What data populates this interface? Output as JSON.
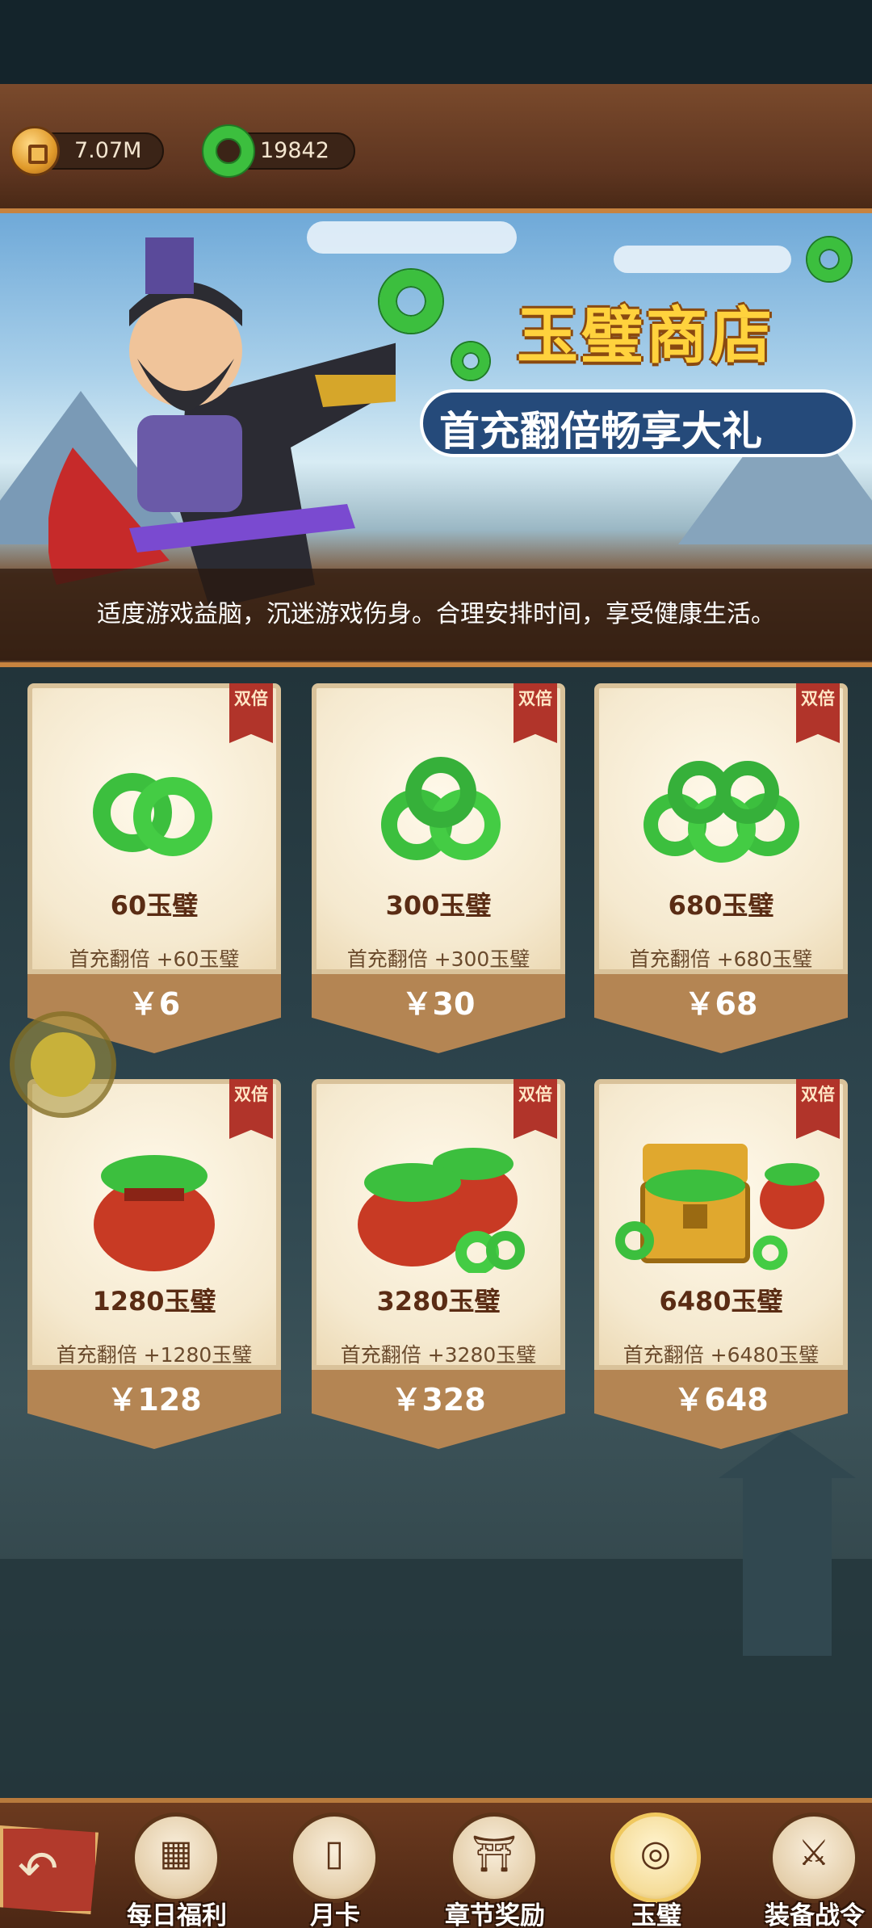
{
  "currency": {
    "coins": "7.07M",
    "jade": "19842",
    "coin_icon": "gold-coin-icon",
    "jade_icon": "jade-disc-icon"
  },
  "banner": {
    "title": "玉璧商店",
    "subtitle": "首充翻倍畅享大礼",
    "tip": "适度游戏益脑，沉迷游戏伤身。合理安排时间，享受健康生活。"
  },
  "shop": {
    "badge": "双倍",
    "items": [
      {
        "name": "60玉璧",
        "bonus": "首充翻倍 +60玉璧",
        "price": "￥6"
      },
      {
        "name": "300玉璧",
        "bonus": "首充翻倍 +300玉璧",
        "price": "￥30"
      },
      {
        "name": "680玉璧",
        "bonus": "首充翻倍 +680玉璧",
        "price": "￥68"
      },
      {
        "name": "1280玉璧",
        "bonus": "首充翻倍 +1280玉璧",
        "price": "￥128"
      },
      {
        "name": "3280玉璧",
        "bonus": "首充翻倍 +3280玉璧",
        "price": "￥328"
      },
      {
        "name": "6480玉璧",
        "bonus": "首充翻倍 +6480玉璧",
        "price": "￥648"
      }
    ]
  },
  "nav": {
    "items": [
      {
        "label": "每日福利",
        "icon": "daily-welfare-icon"
      },
      {
        "label": "月卡",
        "icon": "month-card-icon"
      },
      {
        "label": "章节奖励",
        "icon": "chapter-reward-icon"
      },
      {
        "label": "玉璧",
        "icon": "jade-icon"
      },
      {
        "label": "装备战令",
        "icon": "equipment-pass-icon"
      }
    ],
    "active_index": 3
  },
  "colors": {
    "jade": "#3cbf3e",
    "badge": "#b1342a",
    "title": "#ffd23d",
    "price_band": "#b48553"
  }
}
